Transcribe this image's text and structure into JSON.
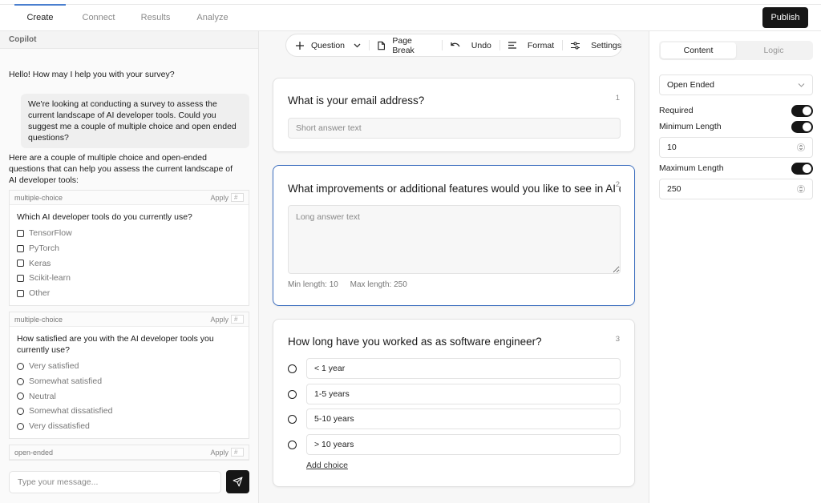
{
  "nav": {
    "tabs": [
      {
        "label": "Create",
        "active": true
      },
      {
        "label": "Connect",
        "active": false
      },
      {
        "label": "Results",
        "active": false
      },
      {
        "label": "Analyze",
        "active": false
      }
    ],
    "publish_label": "Publish"
  },
  "copilot": {
    "title": "Copilot",
    "greeting": "Hello! How may I help you with your survey?",
    "user_message": "We're looking at conducting a survey to assess the current landscape of AI developer tools. Could you suggest me a couple of multiple choice and open ended questions?",
    "reply": "Here are a couple of multiple choice and open-ended questions that can help you assess the current landscape of AI developer tools:",
    "suggestions": [
      {
        "type": "multiple-choice",
        "apply_label": "Apply",
        "num_placeholder": "#",
        "question": "Which AI developer tools do you currently use?",
        "input_kind": "checkbox",
        "options": [
          "TensorFlow",
          "PyTorch",
          "Keras",
          "Scikit-learn",
          "Other"
        ]
      },
      {
        "type": "multiple-choice",
        "apply_label": "Apply",
        "num_placeholder": "#",
        "question": "How satisfied are you with the AI developer tools you currently use?",
        "input_kind": "radio",
        "options": [
          "Very satisfied",
          "Somewhat satisfied",
          "Neutral",
          "Somewhat dissatisfied",
          "Very dissatisfied"
        ]
      },
      {
        "type": "open-ended",
        "apply_label": "Apply",
        "num_placeholder": "#"
      }
    ],
    "message_placeholder": "Type your message...",
    "send_icon": "send-icon"
  },
  "toolbar": {
    "question_label": "Question",
    "page_break_label": "Page Break",
    "undo_label": "Undo",
    "format_label": "Format",
    "settings_label": "Settings"
  },
  "questions": [
    {
      "number": "1",
      "title": "What is your email address?",
      "type": "short",
      "placeholder": "Short answer text"
    },
    {
      "number": "2",
      "title": "What improvements or additional features would you like to see in AI developer tools?",
      "type": "long",
      "placeholder": "Long answer text",
      "min_label": "Min length: 10",
      "max_label": "Max length: 250",
      "selected": true
    },
    {
      "number": "3",
      "title": "How long have you worked as as software engineer?",
      "type": "choice",
      "choices": [
        "< 1 year",
        "1-5 years",
        "5-10 years",
        "> 10 years"
      ],
      "add_choice_label": "Add choice"
    }
  ],
  "properties": {
    "tabs": [
      {
        "label": "Content",
        "active": true
      },
      {
        "label": "Logic",
        "active": false
      }
    ],
    "question_type": "Open Ended",
    "required_label": "Required",
    "required": true,
    "min_length_label": "Minimum Length",
    "min_length_enabled": true,
    "min_length": "10",
    "max_length_label": "Maximum Length",
    "max_length_enabled": true,
    "max_length": "250"
  }
}
